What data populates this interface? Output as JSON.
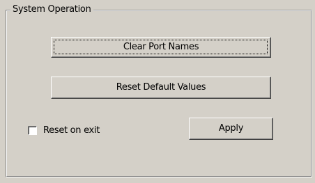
{
  "group": {
    "title": "System Operation"
  },
  "buttons": {
    "clear_port_names": "Clear Port Names",
    "reset_default_values": "Reset Default Values",
    "apply": "Apply"
  },
  "checkbox": {
    "label": "Reset on exit",
    "checked": false
  }
}
